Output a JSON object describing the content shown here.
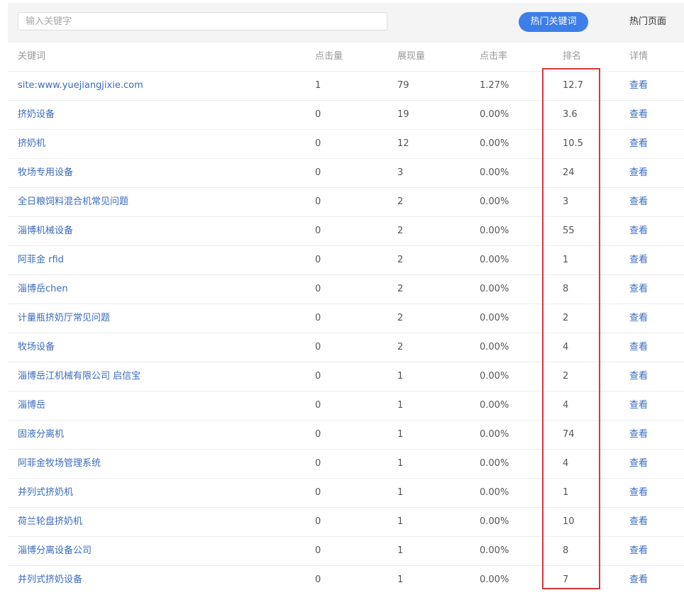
{
  "search": {
    "placeholder": "输入关键字",
    "value": ""
  },
  "tabs": {
    "active_label": "热门关键词",
    "inactive_label": "热门页面"
  },
  "colors": {
    "accent": "#3d7ee8",
    "link": "#3a6bbf",
    "highlight": "#d9363e"
  },
  "table": {
    "headers": {
      "keyword": "关键词",
      "clicks": "点击量",
      "impressions": "展现量",
      "ctr": "点击率",
      "rank": "排名",
      "detail": "详情"
    },
    "rows": [
      {
        "keyword": "site:www.yuejiangjixie.com",
        "clicks": "1",
        "impressions": "79",
        "ctr": "1.27%",
        "rank": "12.7",
        "detail": "查看"
      },
      {
        "keyword": "挤奶设备",
        "clicks": "0",
        "impressions": "19",
        "ctr": "0.00%",
        "rank": "3.6",
        "detail": "查看"
      },
      {
        "keyword": "挤奶机",
        "clicks": "0",
        "impressions": "12",
        "ctr": "0.00%",
        "rank": "10.5",
        "detail": "查看"
      },
      {
        "keyword": "牧场专用设备",
        "clicks": "0",
        "impressions": "3",
        "ctr": "0.00%",
        "rank": "24",
        "detail": "查看"
      },
      {
        "keyword": "全日粮饲料混合机常见问题",
        "clicks": "0",
        "impressions": "2",
        "ctr": "0.00%",
        "rank": "3",
        "detail": "查看"
      },
      {
        "keyword": "淄博机械设备",
        "clicks": "0",
        "impressions": "2",
        "ctr": "0.00%",
        "rank": "55",
        "detail": "查看"
      },
      {
        "keyword": "阿菲金 rfid",
        "clicks": "0",
        "impressions": "2",
        "ctr": "0.00%",
        "rank": "1",
        "detail": "查看"
      },
      {
        "keyword": "淄博岳chen",
        "clicks": "0",
        "impressions": "2",
        "ctr": "0.00%",
        "rank": "8",
        "detail": "查看"
      },
      {
        "keyword": "计量瓶挤奶厅常见问题",
        "clicks": "0",
        "impressions": "2",
        "ctr": "0.00%",
        "rank": "2",
        "detail": "查看"
      },
      {
        "keyword": "牧场设备",
        "clicks": "0",
        "impressions": "2",
        "ctr": "0.00%",
        "rank": "4",
        "detail": "查看"
      },
      {
        "keyword": "淄博岳江机械有限公司 启信宝",
        "clicks": "0",
        "impressions": "1",
        "ctr": "0.00%",
        "rank": "2",
        "detail": "查看"
      },
      {
        "keyword": "淄博岳",
        "clicks": "0",
        "impressions": "1",
        "ctr": "0.00%",
        "rank": "4",
        "detail": "查看"
      },
      {
        "keyword": "固液分离机",
        "clicks": "0",
        "impressions": "1",
        "ctr": "0.00%",
        "rank": "74",
        "detail": "查看"
      },
      {
        "keyword": "阿菲金牧场管理系统",
        "clicks": "0",
        "impressions": "1",
        "ctr": "0.00%",
        "rank": "4",
        "detail": "查看"
      },
      {
        "keyword": "并列式挤奶机",
        "clicks": "0",
        "impressions": "1",
        "ctr": "0.00%",
        "rank": "1",
        "detail": "查看"
      },
      {
        "keyword": "荷兰轮盘挤奶机",
        "clicks": "0",
        "impressions": "1",
        "ctr": "0.00%",
        "rank": "10",
        "detail": "查看"
      },
      {
        "keyword": "淄博分离设备公司",
        "clicks": "0",
        "impressions": "1",
        "ctr": "0.00%",
        "rank": "8",
        "detail": "查看"
      },
      {
        "keyword": "并列式挤奶设备",
        "clicks": "0",
        "impressions": "1",
        "ctr": "0.00%",
        "rank": "7",
        "detail": "查看"
      }
    ]
  }
}
